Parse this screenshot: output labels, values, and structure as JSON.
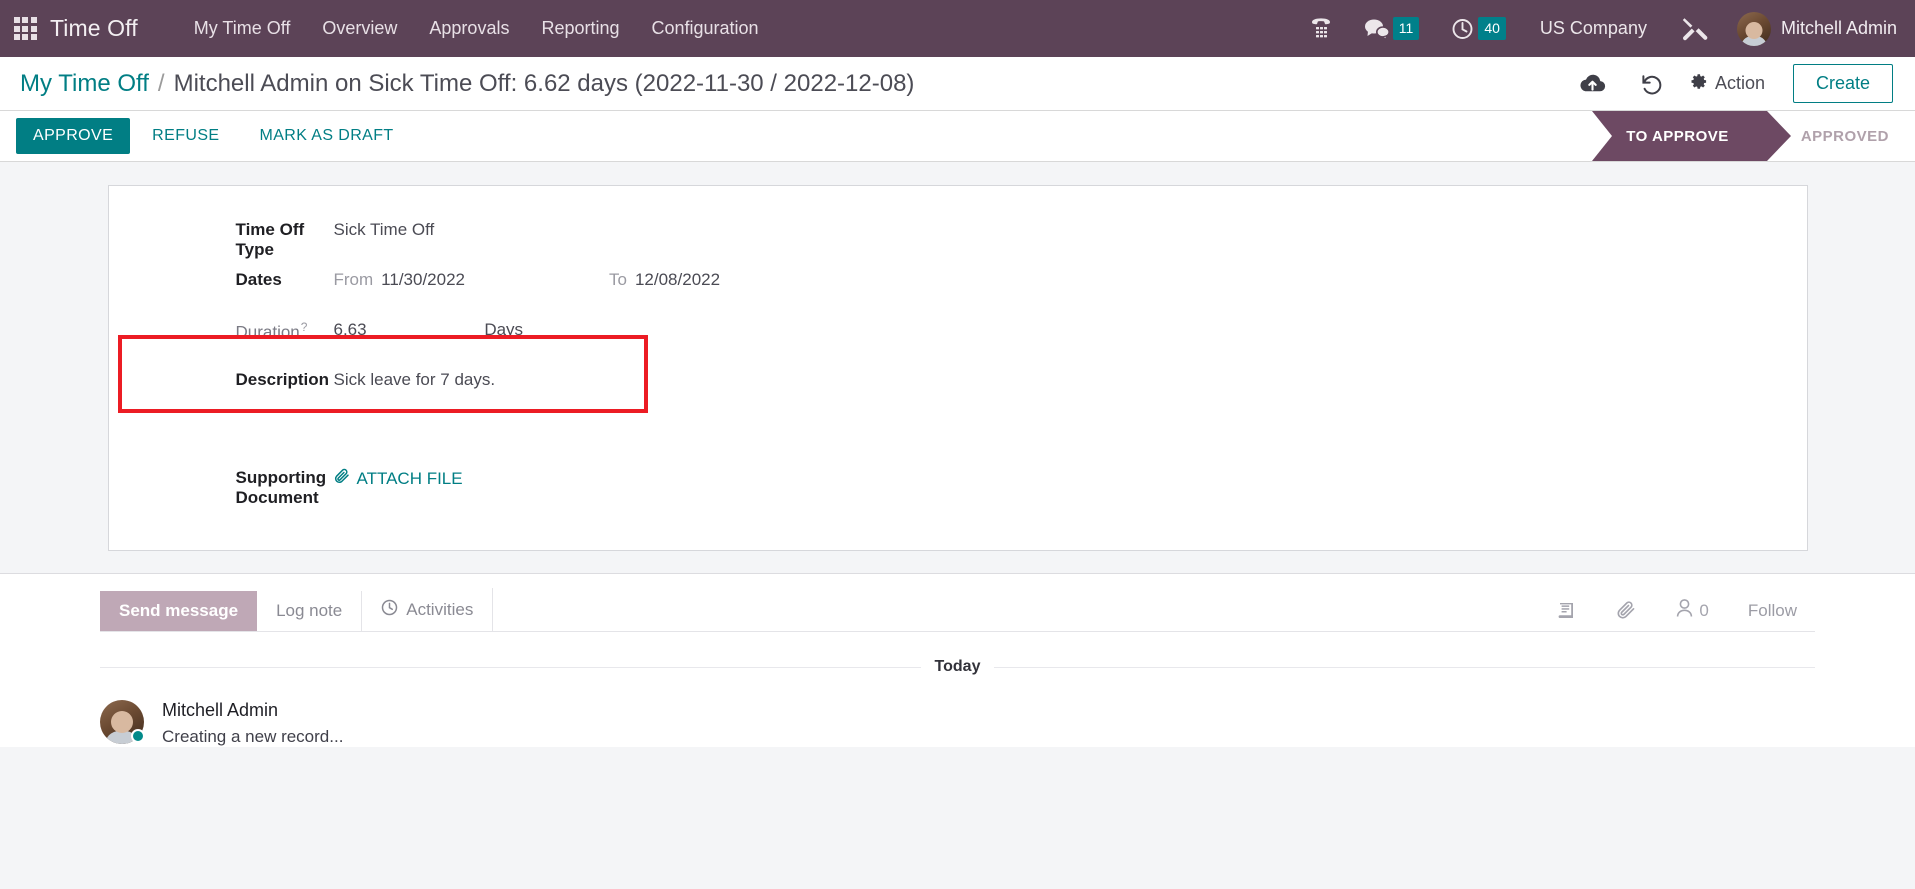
{
  "navbar": {
    "apps_icon": "apps-grid-icon",
    "brand": "Time Off",
    "menu": [
      {
        "label": "My Time Off"
      },
      {
        "label": "Overview"
      },
      {
        "label": "Approvals"
      },
      {
        "label": "Reporting"
      },
      {
        "label": "Configuration"
      }
    ],
    "phone_icon": "phone-dialpad-icon",
    "messages_icon": "chat-bubble-icon",
    "messages_count": "11",
    "activities_icon": "clock-icon",
    "activities_count": "40",
    "company": "US Company",
    "tools_icon": "wrench-screwdriver-icon",
    "user_name": "Mitchell Admin",
    "avatar": "user-avatar"
  },
  "control_panel": {
    "breadcrumb_root": "My Time Off",
    "breadcrumb_sep": "/",
    "breadcrumb_current": "Mitchell Admin on Sick Time Off: 6.62 days (2022-11-30 / 2022-12-08)",
    "save_icon": "cloud-upload-icon",
    "discard_icon": "undo-icon",
    "action_icon": "gear-icon",
    "action_label": "Action",
    "create_label": "Create"
  },
  "statusbar": {
    "buttons": [
      {
        "label": "APPROVE",
        "style": "primary"
      },
      {
        "label": "REFUSE",
        "style": "secondary"
      },
      {
        "label": "MARK AS DRAFT",
        "style": "secondary"
      }
    ],
    "stages": [
      {
        "label": "TO APPROVE",
        "active": true
      },
      {
        "label": "APPROVED",
        "active": false
      }
    ]
  },
  "form": {
    "time_off_type_label": "Time Off Type",
    "time_off_type_value": "Sick Time Off",
    "dates_label": "Dates",
    "dates_from_prefix": "From",
    "dates_from_value": "11/30/2022",
    "dates_to_prefix": "To",
    "dates_to_value": "12/08/2022",
    "duration_label": "Duration",
    "duration_tip": "?",
    "duration_value": "6.63",
    "duration_unit": "Days",
    "description_label": "Description",
    "description_value": "Sick leave for 7 days.",
    "supporting_document_label": "Supporting Document",
    "attach_icon": "paperclip-icon",
    "attach_label": "ATTACH FILE",
    "highlight_color": "#ec1c24"
  },
  "chatter": {
    "tabs": [
      {
        "label": "Send message",
        "active": true,
        "icon": ""
      },
      {
        "label": "Log note",
        "active": false,
        "icon": ""
      },
      {
        "label": "Activities",
        "active": false,
        "icon": "clock-outline-icon"
      }
    ],
    "log_icon": "book-icon",
    "attachment_icon": "paperclip-icon",
    "followers_icon": "user-outline-icon",
    "followers_count": "0",
    "follow_label": "Follow",
    "day_separator": "Today",
    "messages": [
      {
        "author": "Mitchell Admin",
        "body": "Creating a new record...",
        "avatar": "user-avatar"
      }
    ]
  },
  "colors": {
    "navbar_bg": "#5c4357",
    "accent_teal": "#017e84",
    "stage_active": "#6d4963",
    "highlight_red": "#ec1c24",
    "chatter_tab_active": "#bfa8b6"
  }
}
